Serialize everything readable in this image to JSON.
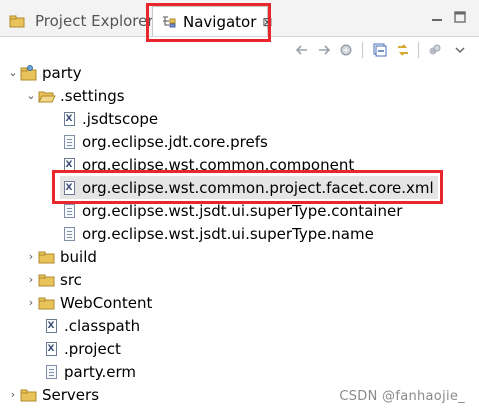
{
  "tabs": {
    "inactive_label": "Project Explorer",
    "active_label": "Navigator",
    "close_glyph": "⊠"
  },
  "toolbar": {
    "icons": [
      "back-icon",
      "forward-icon",
      "go-into-icon",
      "collapse-all-icon",
      "link-with-editor-icon",
      "view-menu-icon",
      "chevron-down-icon"
    ]
  },
  "tree": {
    "party": "party",
    "settings": ".settings",
    "jsdtscope": ".jsdtscope",
    "jdt_prefs": "org.eclipse.jdt.core.prefs",
    "wst_component": "org.eclipse.wst.common.component",
    "facet_xml": "org.eclipse.wst.common.project.facet.core.xml",
    "jsdt_container": "org.eclipse.wst.jsdt.ui.superType.container",
    "jsdt_name": "org.eclipse.wst.jsdt.ui.superType.name",
    "build": "build",
    "src": "src",
    "webcontent": "WebContent",
    "classpath": ".classpath",
    "project": ".project",
    "erm": "party.erm",
    "servers": "Servers"
  },
  "watermark": "CSDN @fanhaojie_",
  "colors": {
    "highlight_border": "#e8262c",
    "folder": "#e8c35a",
    "selection": "#e5e5e5"
  }
}
